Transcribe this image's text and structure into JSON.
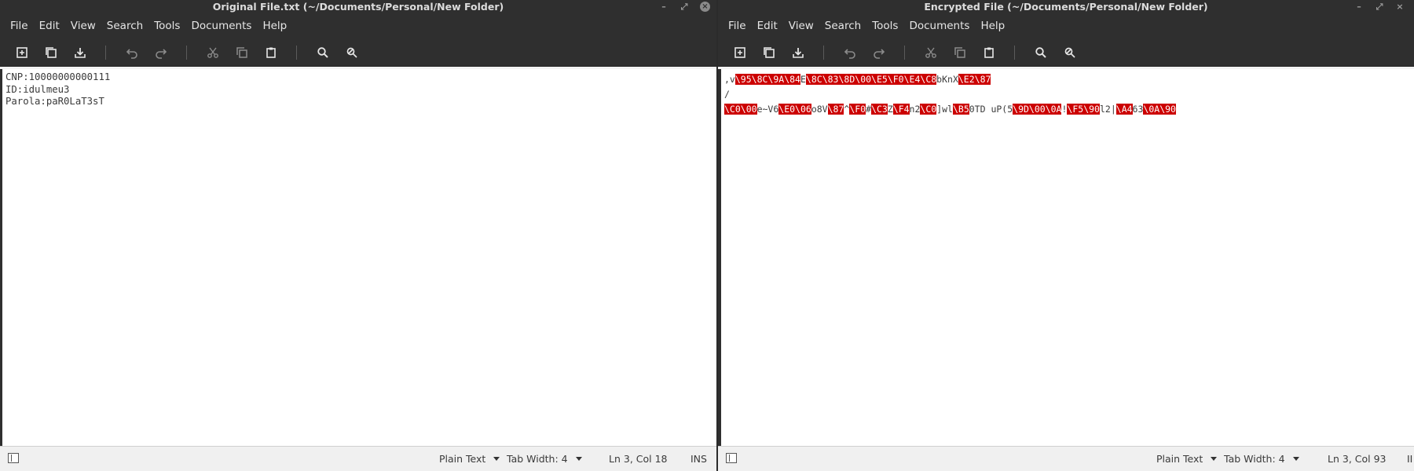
{
  "left": {
    "title": "Original File.txt (~/Documents/Personal/New Folder)",
    "menu": [
      "File",
      "Edit",
      "View",
      "Search",
      "Tools",
      "Documents",
      "Help"
    ],
    "lines": [
      "CNP:10000000000111",
      "ID:idulmeu3",
      "Parola:paR0LaT3sT"
    ],
    "status": {
      "mode": "Plain Text",
      "tab_width": "Tab Width:  4",
      "position": "Ln 3, Col 18",
      "ins": "INS"
    }
  },
  "right": {
    "title": "Encrypted File (~/Documents/Personal/New Folder)",
    "menu": [
      "File",
      "Edit",
      "View",
      "Search",
      "Tools",
      "Documents",
      "Help"
    ],
    "lines": [
      ",v\\95\\8C\\9A\\84E\\8C\\83\\8D\\00\\E5\\F0\\E4\\C8bKnX\\E2\\87",
      "/",
      "\\C0\\00e~V6\\E0\\06o8V\\87^\\F0#\\C3Z\\F4n2\\C0]wl\\B50TD uP(5\\9D\\00\\0A!\\F5\\90l2|\\A463\\0A\\90"
    ],
    "status": {
      "mode": "Plain Text",
      "tab_width": "Tab Width:  4",
      "position": "Ln 3, Col 93",
      "ins": "II"
    }
  },
  "colors": {
    "chrome": "#2f2f2f",
    "editor_bg": "#ffffff",
    "invalid_byte": "#cc0000"
  }
}
